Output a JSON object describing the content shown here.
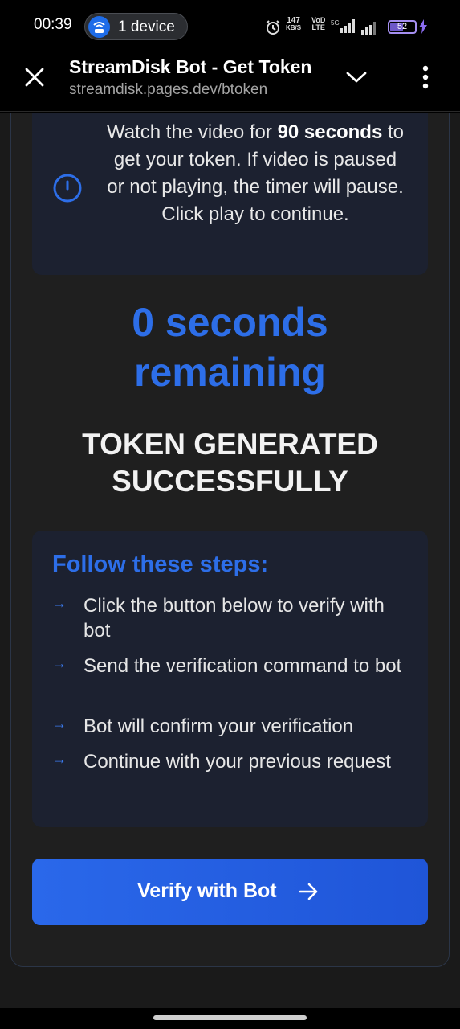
{
  "status_bar": {
    "time": "00:39",
    "device_pill": "1 device",
    "net_speed_value": "147",
    "net_speed_unit": "KB/S",
    "volte_top": "VoD",
    "volte_bottom": "LTE",
    "network_type": "5G",
    "battery": "52",
    "battery_level": 0.52
  },
  "browser": {
    "title": "StreamDisk Bot - Get Token",
    "url": "streamdisk.pages.dev/btoken"
  },
  "notice": {
    "text_before": "Watch the video for ",
    "text_bold": "90 seconds",
    "text_after": " to get your token. If video is paused or not playing, the timer will pause. Click play to continue."
  },
  "timer": {
    "line1": "0 seconds",
    "line2": "remaining"
  },
  "status_message": {
    "line1": "TOKEN GENERATED",
    "line2": "SUCCESSFULLY"
  },
  "steps": {
    "title": "Follow these steps:",
    "arrow": "→",
    "items": [
      "Click the button below to verify with bot",
      "Send the verification command to bot",
      "Bot will confirm your verification",
      "Continue with your previous request"
    ]
  },
  "verify_button": {
    "label": "Verify with Bot"
  },
  "colors": {
    "accent": "#2d6ee8",
    "panel": "#1c2130",
    "background": "#1a1a1a"
  }
}
